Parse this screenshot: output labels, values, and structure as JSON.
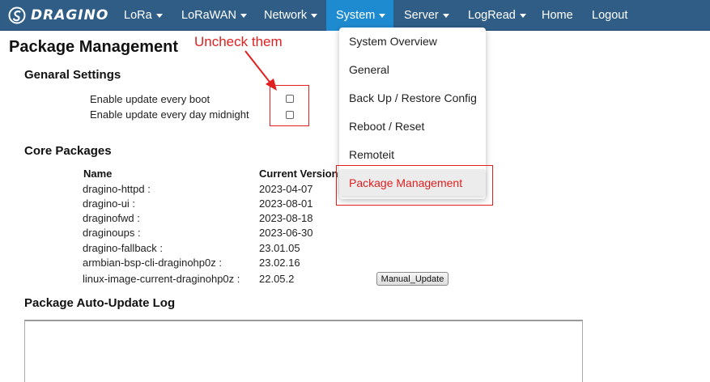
{
  "brand": {
    "logo_text": "DRAGINO"
  },
  "nav": {
    "items": [
      {
        "label": "LoRa",
        "dropdown": true
      },
      {
        "label": "LoRaWAN",
        "dropdown": true
      },
      {
        "label": "Network",
        "dropdown": true
      },
      {
        "label": "System",
        "dropdown": true,
        "active": true
      },
      {
        "label": "Server",
        "dropdown": true
      },
      {
        "label": "LogRead",
        "dropdown": true
      },
      {
        "label": "Home",
        "dropdown": false
      },
      {
        "label": "Logout",
        "dropdown": false
      }
    ]
  },
  "page": {
    "title": "Package Management",
    "general": {
      "heading": "Genaral Settings",
      "update_every_boot": {
        "label": "Enable update every boot",
        "checked": false
      },
      "update_every_midnight": {
        "label": "Enable update every day midnight",
        "checked": false
      }
    },
    "core": {
      "heading": "Core Packages",
      "columns": [
        "Name",
        "Current Version"
      ],
      "rows": [
        {
          "name": "dragino-httpd :",
          "version": "2023-04-07"
        },
        {
          "name": "dragino-ui :",
          "version": "2023-08-01"
        },
        {
          "name": "draginofwd :",
          "version": "2023-08-18"
        },
        {
          "name": "draginoups :",
          "version": "2023-06-30"
        },
        {
          "name": "dragino-fallback :",
          "version": "23.01.05"
        },
        {
          "name": "armbian-bsp-cli-draginohp0z :",
          "version": "23.02.16"
        },
        {
          "name": "linux-image-current-draginohp0z :",
          "version": "22.05.2"
        }
      ],
      "manual_update_label": "Manual_Update"
    },
    "log": {
      "heading": "Package Auto-Update Log"
    }
  },
  "system_menu": {
    "items": [
      {
        "label": "System Overview"
      },
      {
        "label": "General"
      },
      {
        "label": "Back Up / Restore Config"
      },
      {
        "label": "Reboot / Reset"
      },
      {
        "label": "Remoteit"
      },
      {
        "label": "Package Management",
        "current": true
      }
    ]
  },
  "annotation": {
    "text": "Uncheck them",
    "color": "#e02020"
  },
  "colors": {
    "navbar": "#2f5d86",
    "active_nav": "#1e8bd0",
    "highlight": "#e02020"
  }
}
